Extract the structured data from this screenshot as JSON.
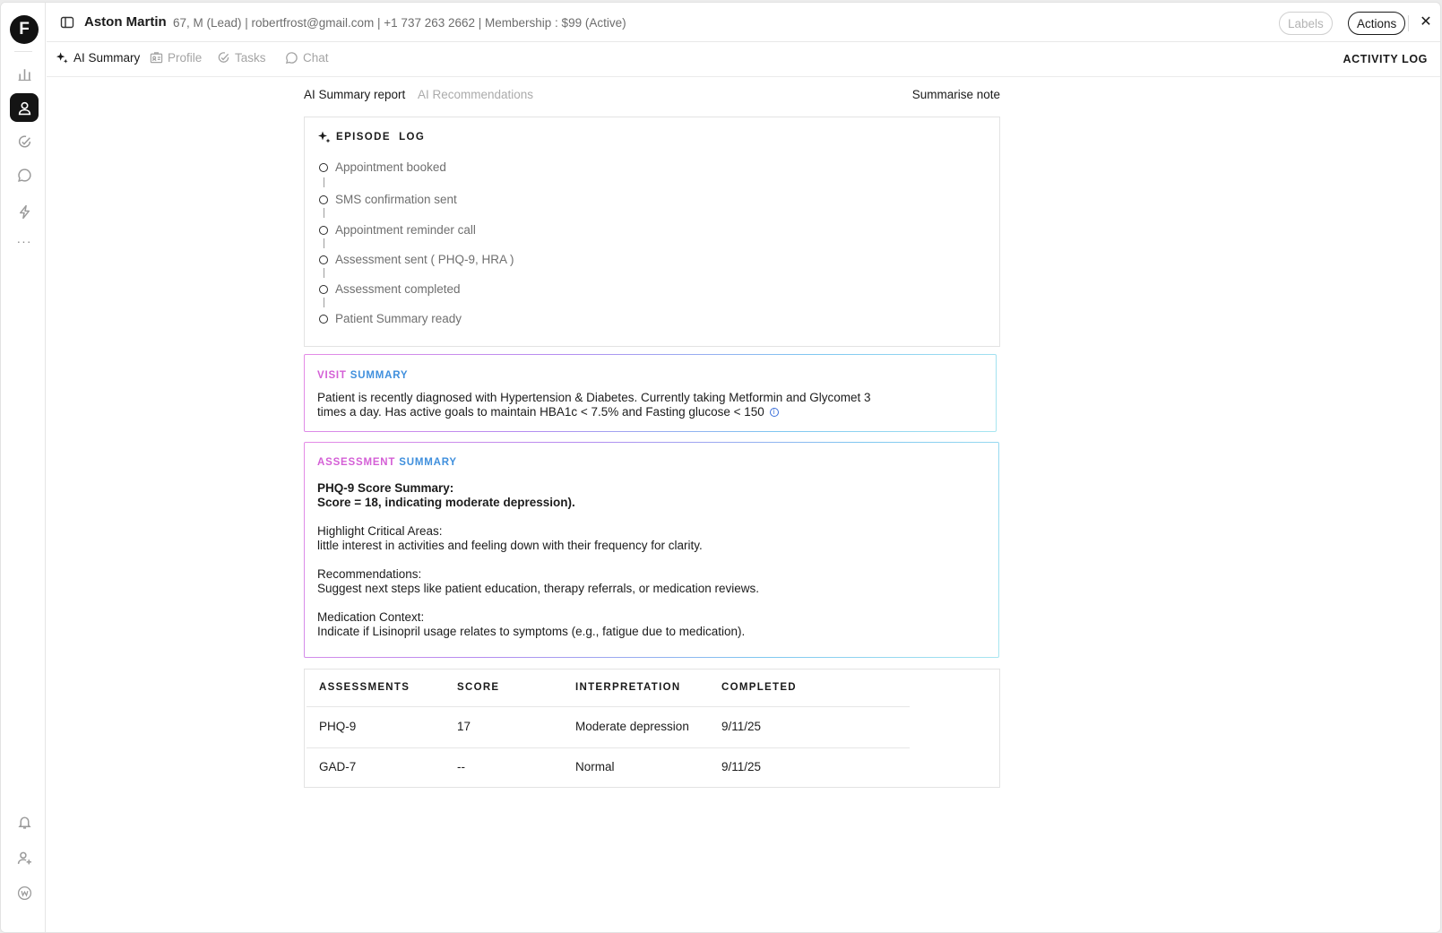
{
  "rail": {
    "logo": "F",
    "items": [
      "analytics-icon",
      "profile-icon",
      "tasks-icon",
      "chat-icon",
      "lightning-icon",
      "more-icon"
    ],
    "bottom": [
      "bell-icon",
      "add-user-icon",
      "w-badge-icon"
    ],
    "dots": "···"
  },
  "header": {
    "name": "Aston Martin",
    "meta": "67, M (Lead)  | robertfrost@gmail.com  | +1 737 263 2662  | Membership : $99 (Active)",
    "labels_button": "Labels",
    "actions_button": "Actions",
    "close": "✕"
  },
  "tabs": [
    {
      "label": "AI Summary",
      "active": true
    },
    {
      "label": "Profile",
      "active": false
    },
    {
      "label": "Tasks",
      "active": false
    },
    {
      "label": "Chat",
      "active": false
    }
  ],
  "activity_log": "ACTIVITY LOG",
  "subtabs": {
    "report": "AI Summary report",
    "recommendations": "AI Recommendations",
    "summarise": "Summarise note"
  },
  "episode": {
    "title": "EPISODE  LOG",
    "items": [
      "Appointment booked",
      "SMS confirmation sent",
      "Appointment reminder call",
      "Assessment sent ( PHQ-9, HRA )",
      "Assessment completed",
      "Patient Summary ready"
    ]
  },
  "visit_summary": {
    "title_1": "VISIT",
    "title_2": "SUMMARY",
    "text": "Patient is recently diagnosed with Hypertension & Diabetes. Currently taking Metformin and Glycomet 3 times a day. Has active goals to maintain HBA1c < 7.5% and Fasting glucose < 150",
    "info": "i"
  },
  "assessment_summary": {
    "title_1": "ASSESSMENT",
    "title_2": "SUMMARY",
    "score_heading": "PHQ-9 Score Summary:",
    "score_line": "Score = 18, indicating moderate depression).",
    "critical_heading": "Highlight Critical Areas:",
    "critical_text": "little interest in activities and feeling down with their frequency for clarity.",
    "rec_heading": "Recommendations:",
    "rec_text": "Suggest next steps like patient education, therapy referrals, or medication reviews.",
    "med_heading": "Medication Context:",
    "med_text": "Indicate if Lisinopril usage relates to symptoms (e.g., fatigue due to medication)."
  },
  "assessments_table": {
    "headers": [
      "ASSESSMENTS",
      "SCORE",
      "INTERPRETATION",
      "COMPLETED"
    ],
    "rows": [
      [
        "PHQ-9",
        "17",
        "Moderate depression",
        "9/11/25"
      ],
      [
        "GAD-7",
        "--",
        "Normal",
        "9/11/25"
      ]
    ]
  }
}
